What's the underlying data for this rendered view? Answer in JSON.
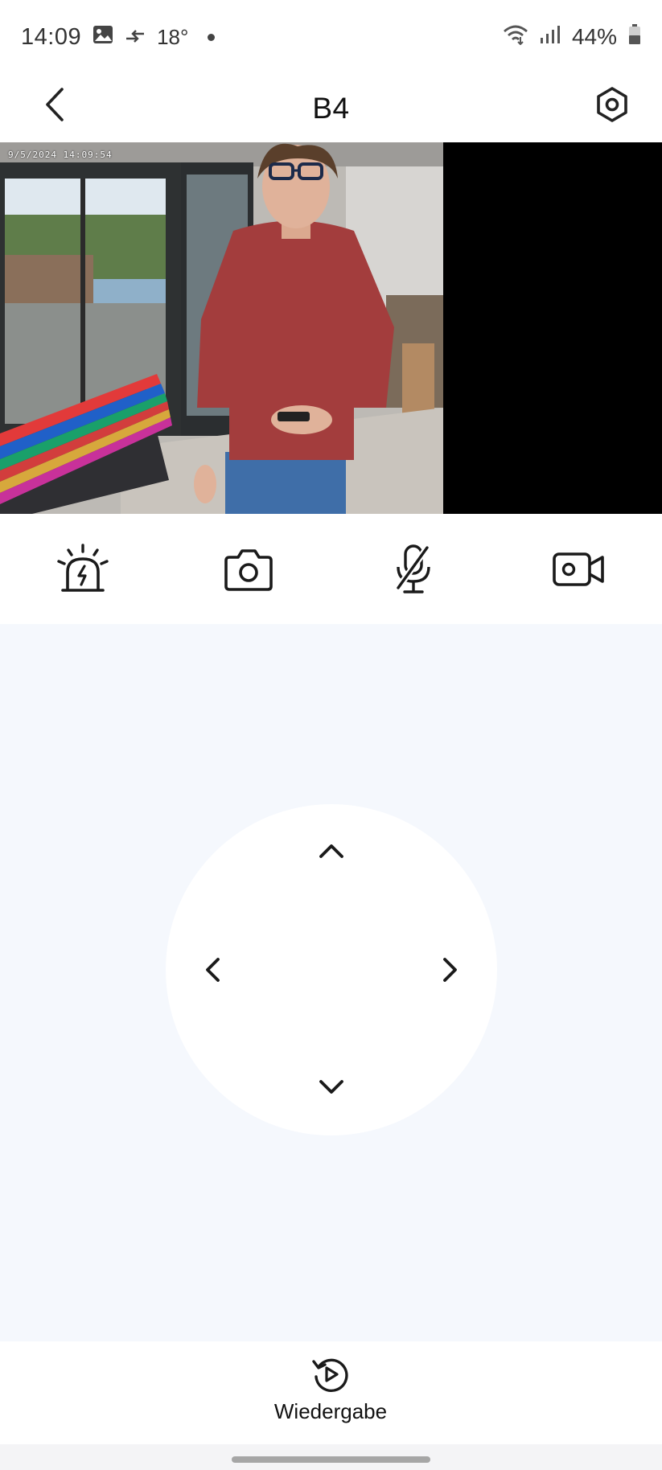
{
  "status_bar": {
    "time": "14:09",
    "temperature": "18°",
    "battery": "44%",
    "icons": [
      "gallery-icon",
      "data-transfer-icon",
      "notification-dot",
      "wifi-icon",
      "signal-icon",
      "battery-icon"
    ]
  },
  "header": {
    "title": "B4",
    "back_icon": "chevron-left-icon",
    "settings_icon": "settings-hexagon-icon"
  },
  "video": {
    "timestamp": "9/5/2024 14:09:54"
  },
  "controls": [
    {
      "name": "siren-button",
      "icon": "siren-icon"
    },
    {
      "name": "snapshot-button",
      "icon": "camera-icon"
    },
    {
      "name": "mute-mic-button",
      "icon": "mic-off-icon"
    },
    {
      "name": "record-button",
      "icon": "video-camera-icon"
    }
  ],
  "ptz": {
    "arrows": [
      "chevron-up-icon",
      "chevron-left-icon",
      "chevron-right-icon",
      "chevron-down-icon"
    ]
  },
  "bottom": {
    "playback_label": "Wiedergabe",
    "playback_icon": "replay-icon"
  },
  "colors": {
    "panel_background": "#f5f8fd",
    "icon": "#1a1a1a",
    "video_background": "#000000"
  }
}
